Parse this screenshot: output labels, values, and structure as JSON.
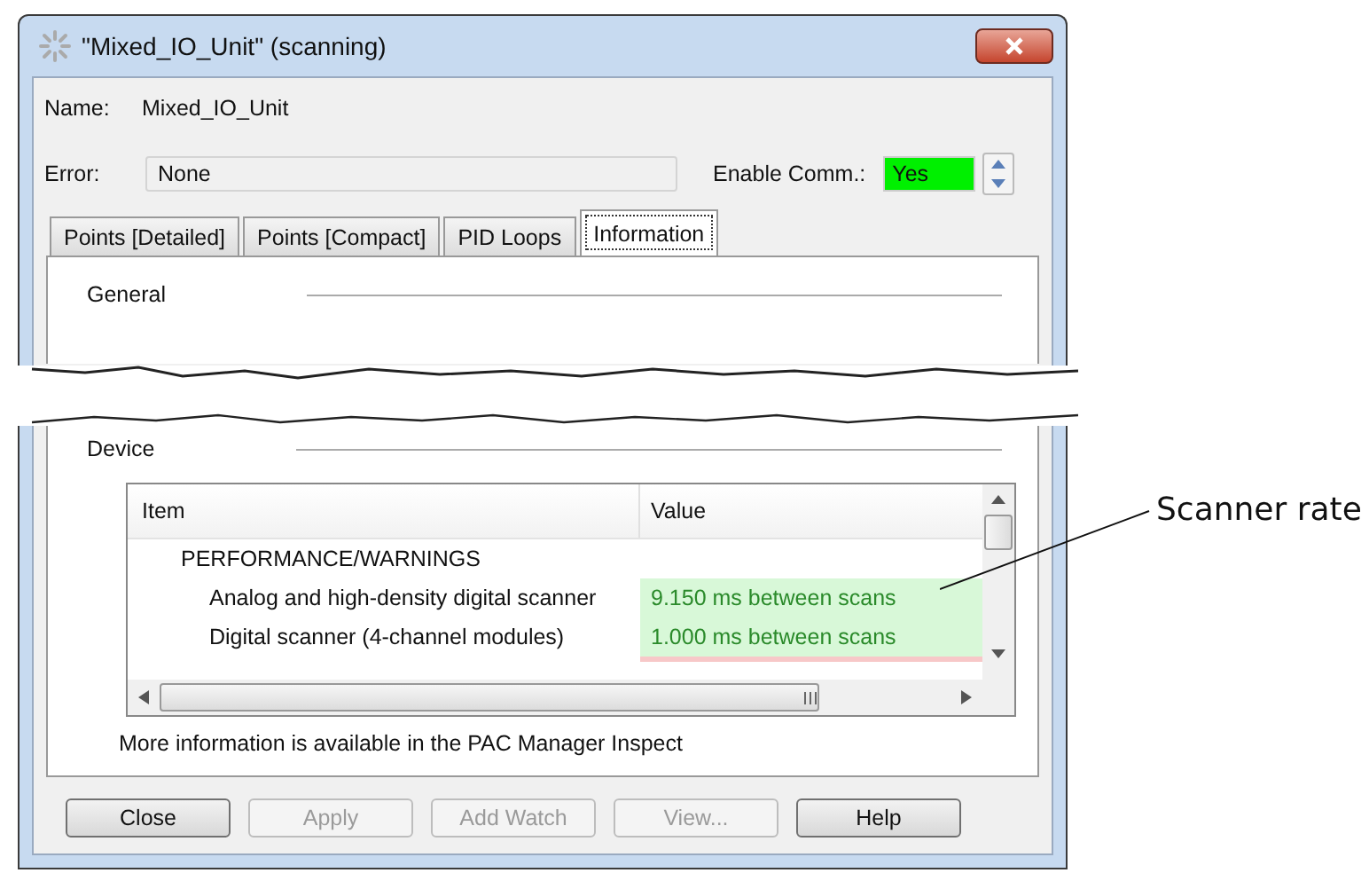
{
  "window": {
    "title": "\"Mixed_IO_Unit\" (scanning)"
  },
  "name": {
    "label": "Name:",
    "value": "Mixed_IO_Unit"
  },
  "error": {
    "label": "Error:",
    "value": "None"
  },
  "enable_comm": {
    "label": "Enable Comm.:",
    "value": "Yes",
    "on": true
  },
  "tabs": [
    {
      "label": "Points [Detailed]",
      "selected": false
    },
    {
      "label": "Points [Compact]",
      "selected": false
    },
    {
      "label": "PID Loops",
      "selected": false
    },
    {
      "label": "Information",
      "selected": true
    }
  ],
  "sections": {
    "top": "General",
    "bottom": "Device"
  },
  "table": {
    "columns": [
      "Item",
      "Value"
    ],
    "rows": [
      {
        "kind": "heading",
        "item": "PERFORMANCE/WARNINGS"
      },
      {
        "kind": "item",
        "item": "Analog and high-density digital scanner",
        "value": "9.150 ms between scans"
      },
      {
        "kind": "item",
        "item": "Digital scanner (4-channel modules)",
        "value": "1.000 ms between scans"
      }
    ]
  },
  "note": "More information is available in the PAC Manager Inspect",
  "buttons": [
    {
      "label": "Close",
      "disabled": false
    },
    {
      "label": "Apply",
      "disabled": true
    },
    {
      "label": "Add Watch",
      "disabled": true
    },
    {
      "label": "View...",
      "disabled": true
    },
    {
      "label": "Help",
      "disabled": false
    }
  ],
  "callout": "Scanner rate"
}
